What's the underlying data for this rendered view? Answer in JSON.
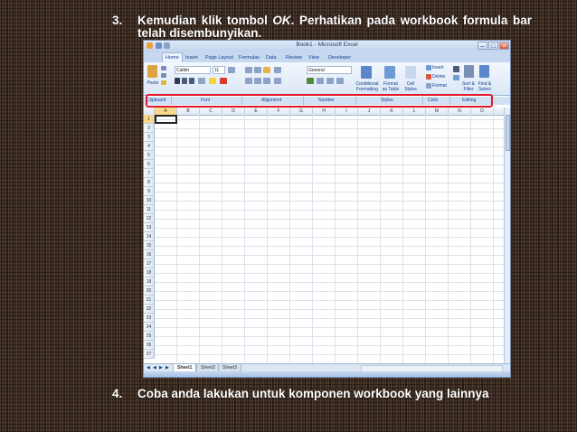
{
  "instructions": {
    "step3": {
      "number": "3.",
      "text_before": "Kemudian klik tombol ",
      "ok_word": "OK",
      "text_after": ". Perhatikan pada workbook formula bar telah disembunyikan."
    },
    "step4": {
      "number": "4.",
      "text": "Coba anda lakukan untuk komponen workbook yang lainnya"
    }
  },
  "excel": {
    "title": "Book1 - Microsoft Excel",
    "window_buttons": [
      "–",
      "□",
      "×"
    ],
    "tabs": [
      "Home",
      "Insert",
      "Page Layout",
      "Formulas",
      "Data",
      "Review",
      "View",
      "Developer"
    ],
    "active_tab": "Home",
    "ribbon": {
      "paste_label": "Paste",
      "font_name": "Calibri",
      "font_size": "11",
      "number_format": "General",
      "conditional_formatting_label": "Conditional Formatting",
      "format_as_table_label": "Format as Table",
      "cell_styles_label": "Cell Styles",
      "insert_label": "Insert",
      "delete_label": "Delete",
      "format_label": "Format",
      "sort_filter_label": "Sort & Filter",
      "find_select_label": "Find & Select",
      "group_labels": [
        "Clipboard",
        "Font",
        "Alignment",
        "Number",
        "Styles",
        "Cells",
        "Editing"
      ]
    },
    "columns": [
      "A",
      "B",
      "C",
      "D",
      "E",
      "F",
      "G",
      "H",
      "I",
      "J",
      "K",
      "L",
      "M",
      "N",
      "O"
    ],
    "rows": [
      "1",
      "2",
      "3",
      "4",
      "5",
      "6",
      "7",
      "8",
      "9",
      "10",
      "11",
      "12",
      "13",
      "14",
      "15",
      "16",
      "17",
      "18",
      "19",
      "20",
      "21",
      "22",
      "23",
      "24",
      "25",
      "26",
      "27"
    ],
    "active_cell": "A1",
    "sheets": [
      "Sheet1",
      "Sheet2",
      "Sheet3"
    ],
    "active_sheet": "Sheet1",
    "highlight_color": "#e01a2a"
  }
}
